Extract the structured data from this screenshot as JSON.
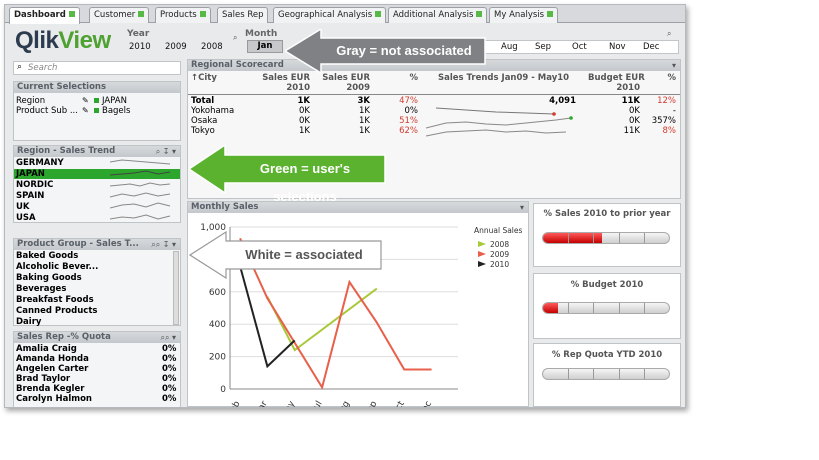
{
  "tabs": [
    {
      "label": "Dashboard",
      "dot": true
    },
    {
      "label": "Customer",
      "dot": true
    },
    {
      "label": "Products",
      "dot": true
    },
    {
      "label": "Sales Rep",
      "dot": false
    },
    {
      "label": "Geographical Analysis",
      "dot": true
    },
    {
      "label": "Additional Analysis",
      "dot": true
    },
    {
      "label": "My Analysis",
      "dot": true
    }
  ],
  "logo": {
    "brand_a": "Qlik",
    "brand_b": "View"
  },
  "year": {
    "label": "Year",
    "values": [
      "2010",
      "2009",
      "2008"
    ]
  },
  "month": {
    "label": "Month",
    "selected": "Jan",
    "values": [
      "Aug",
      "Sep",
      "Oct",
      "Nov",
      "Dec"
    ]
  },
  "search": {
    "placeholder": "Search"
  },
  "current_selections": {
    "title": "Current Selections",
    "rows": [
      {
        "field": "Region",
        "value": "JAPAN"
      },
      {
        "field": "Product Sub ...",
        "value": "Bagels"
      }
    ]
  },
  "region": {
    "title": "Region - Sales Trend",
    "items": [
      "GERMANY",
      "JAPAN",
      "NORDIC",
      "SPAIN",
      "UK",
      "USA"
    ],
    "selected": "JAPAN"
  },
  "product_group": {
    "title": "Product Group - Sales T...",
    "items": [
      "Baked Goods",
      "Alcoholic Bever...",
      "Baking Goods",
      "Beverages",
      "Breakfast Foods",
      "Canned Products",
      "Dairy"
    ]
  },
  "sales_rep": {
    "title": "Sales Rep -% Quota",
    "rows": [
      {
        "name": "Amalia Craig",
        "pct": "0%"
      },
      {
        "name": "Amanda Honda",
        "pct": "0%"
      },
      {
        "name": "Angelen Carter",
        "pct": "0%"
      },
      {
        "name": "Brad Taylor",
        "pct": "0%"
      },
      {
        "name": "Brenda Kegler",
        "pct": "0%"
      },
      {
        "name": "Carolyn Halmon",
        "pct": "0%"
      }
    ]
  },
  "scorecard": {
    "title": "Regional Scorecard",
    "headers": {
      "city": "City",
      "sales2010": "Sales EUR",
      "sales2010b": "2010",
      "sales2009": "Sales EUR",
      "sales2009b": "2009",
      "pct": "%",
      "trend": "Sales Trends Jan09 - May10",
      "budget": "Budget EUR",
      "budgetb": "2010",
      "pct2": "%"
    },
    "rows": [
      {
        "city": "Total",
        "s10": "1K",
        "s09": "3K",
        "pct": "47%",
        "trend": "4,091",
        "budget": "11K",
        "pct2": "12%"
      },
      {
        "city": "Yokohama",
        "s10": "0K",
        "s09": "1K",
        "pct": "0%",
        "trend": "",
        "budget": "0K",
        "pct2": "-"
      },
      {
        "city": "Osaka",
        "s10": "0K",
        "s09": "1K",
        "pct": "51%",
        "trend": "",
        "budget": "0K",
        "pct2": "357%"
      },
      {
        "city": "Tokyo",
        "s10": "1K",
        "s09": "1K",
        "pct": "62%",
        "trend": "",
        "budget": "11K",
        "pct2": "8%"
      }
    ]
  },
  "monthly_sales": {
    "title": "Monthly Sales"
  },
  "chart_data": {
    "type": "line",
    "title": "Monthly Sales",
    "legend_title": "Annual Sales",
    "categories": [
      "Feb",
      "Mar",
      "May",
      "Jul",
      "Aug",
      "Sep",
      "Oct",
      "Dec"
    ],
    "yticks": [
      "1,000",
      "800",
      "600",
      "400",
      "200",
      "0"
    ],
    "ylim": [
      0,
      1000
    ],
    "series": [
      {
        "name": "2008",
        "color": "#a8c93a",
        "points": [
          [
            2,
            570
          ],
          [
            3,
            240
          ],
          [
            6,
            620
          ]
        ]
      },
      {
        "name": "2009",
        "color": "#e8604a",
        "points": [
          [
            1,
            930
          ],
          [
            2,
            560
          ],
          [
            4,
            10
          ],
          [
            5,
            660
          ],
          [
            6,
            410
          ],
          [
            7,
            120
          ],
          [
            8,
            120
          ]
        ]
      },
      {
        "name": "2010",
        "color": "#222222",
        "points": [
          [
            1,
            760
          ],
          [
            2,
            140
          ],
          [
            3,
            300
          ]
        ]
      }
    ],
    "legend_position": "top-right"
  },
  "gauges": [
    {
      "title": "% Sales 2010 to prior year",
      "value": 0.47
    },
    {
      "title": "% Budget 2010",
      "value": 0.12
    },
    {
      "title": "% Rep Quota YTD 2010",
      "value": 0
    }
  ],
  "callouts": {
    "gray": "Gray = not associated",
    "green": "Green = user's selections",
    "white": "White = associated"
  }
}
